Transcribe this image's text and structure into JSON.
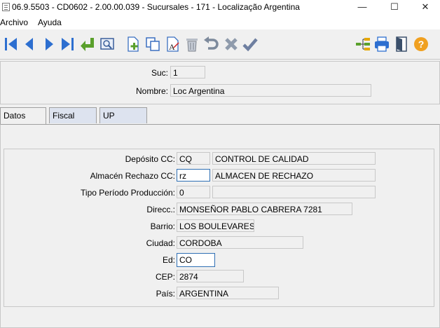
{
  "window": {
    "title": "06.9.5503 - CD0602 - 2.00.00.039 - Sucursales - 171 - Localização Argentina",
    "minimize_glyph": "—",
    "maximize_glyph": "☐",
    "close_glyph": "✕"
  },
  "menu": {
    "items": [
      "Archivo",
      "Ayuda"
    ]
  },
  "toolbar": {
    "icons": [
      "first-icon",
      "prev-icon",
      "next-icon",
      "last-icon",
      "enter-icon",
      "preview-icon",
      "new-record-icon",
      "copy-icon",
      "edit-icon",
      "delete-icon",
      "undo-icon",
      "cancel-icon",
      "confirm-icon",
      "tree-icon",
      "print-icon",
      "exit-icon",
      "help-icon"
    ],
    "help_glyph": "?",
    "edit_glyph": "A"
  },
  "header": {
    "suc_label": "Suc:",
    "suc_value": "1",
    "nombre_label": "Nombre:",
    "nombre_value": "Loc Argentina"
  },
  "tabs": [
    "Datos",
    "Fiscal",
    "UP"
  ],
  "active_tab": "Datos",
  "form": {
    "deposito_label": "Depósito CC:",
    "deposito_code": "CQ",
    "deposito_desc": "CONTROL DE CALIDAD",
    "rechazo_label": "Almacén Rechazo CC:",
    "rechazo_code": "rz",
    "rechazo_desc": "ALMACEN DE RECHAZO",
    "periodo_label": "Tipo Período Producción:",
    "periodo_code": "0",
    "periodo_desc": "",
    "direcc_label": "Direcc.:",
    "direcc_value": "MONSEÑOR PABLO CABRERA 7281",
    "barrio_label": "Barrio:",
    "barrio_value": "LOS BOULEVARES",
    "ciudad_label": "Ciudad:",
    "ciudad_value": "CORDOBA",
    "ed_label": "Ed:",
    "ed_value": "CO",
    "cep_label": "CEP:",
    "cep_value": "2874",
    "pais_label": "País:",
    "pais_value": "ARGENTINA"
  },
  "colors": {
    "focus_border": "#2f6fb4",
    "toolbar_blue": "#2d6fd0",
    "toolbar_green": "#5aa02c",
    "help_orange": "#f0a020"
  }
}
